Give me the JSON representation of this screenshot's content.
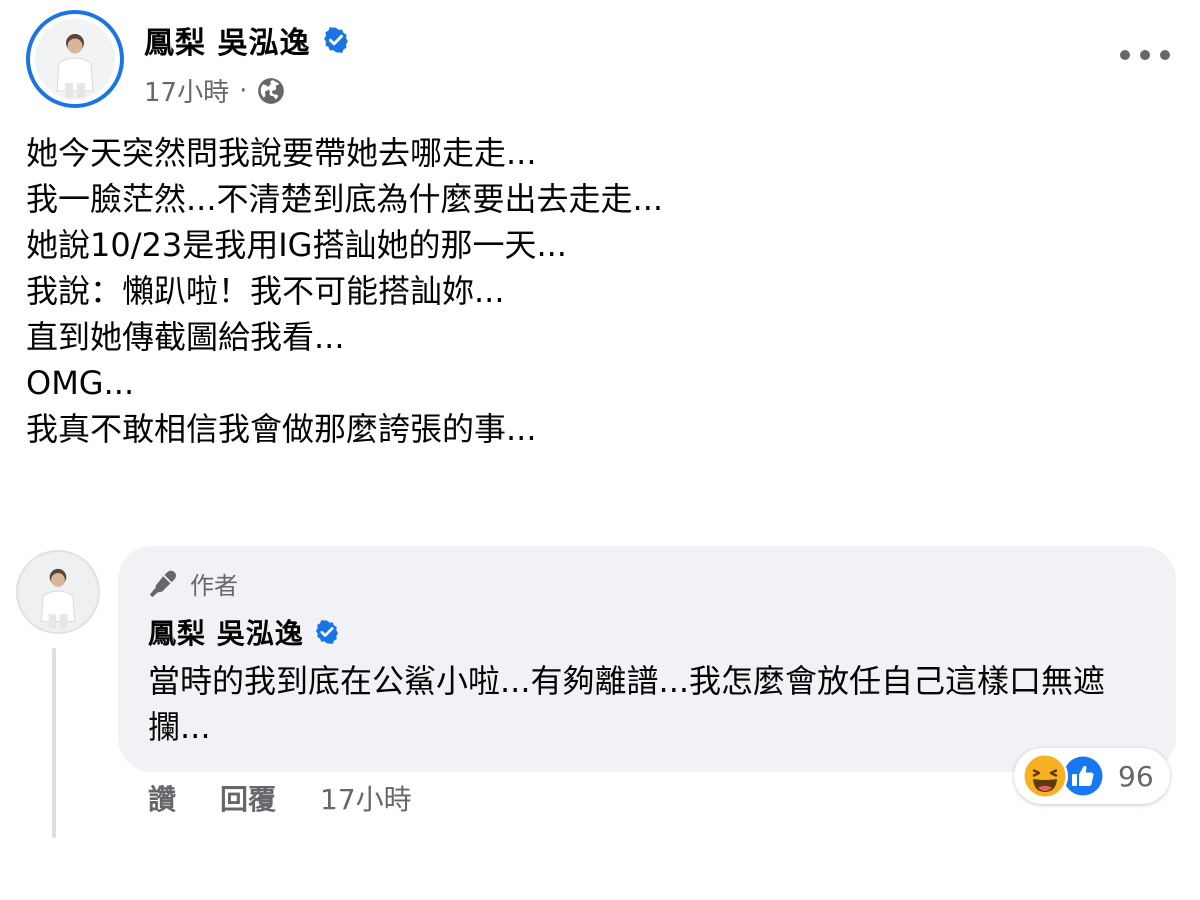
{
  "post": {
    "author": "鳳梨 吳泓逸",
    "time": "17小時",
    "separator": "·",
    "verified_icon": "verified-badge-icon",
    "privacy_icon": "globe-icon",
    "lines": [
      "她今天突然問我說要帶她去哪走走...",
      "我一臉茫然...不清楚到底為什麼要出去走走...",
      "她說10/23是我用IG搭訕她的那一天...",
      "我說：懶趴啦！我不可能搭訕妳...",
      "直到她傳截圖給我看...",
      "OMG...",
      "我真不敢相信我會做那麼誇張的事..."
    ]
  },
  "comment": {
    "badge_label": "作者",
    "author": "鳳梨 吳泓逸",
    "text": "當時的我到底在公鯊小啦...有夠離譜...我怎麼會放任自己這樣口無遮攔...",
    "reaction_count": "96",
    "reactions": [
      "haha-icon",
      "like-icon"
    ],
    "actions": {
      "like": "讚",
      "reply": "回覆",
      "time": "17小時"
    }
  },
  "colors": {
    "accent": "#1b74e4",
    "secondary_text": "#65676b",
    "bubble": "#f0f2f5",
    "haha": "#f7b125",
    "like": "#1877f2"
  }
}
